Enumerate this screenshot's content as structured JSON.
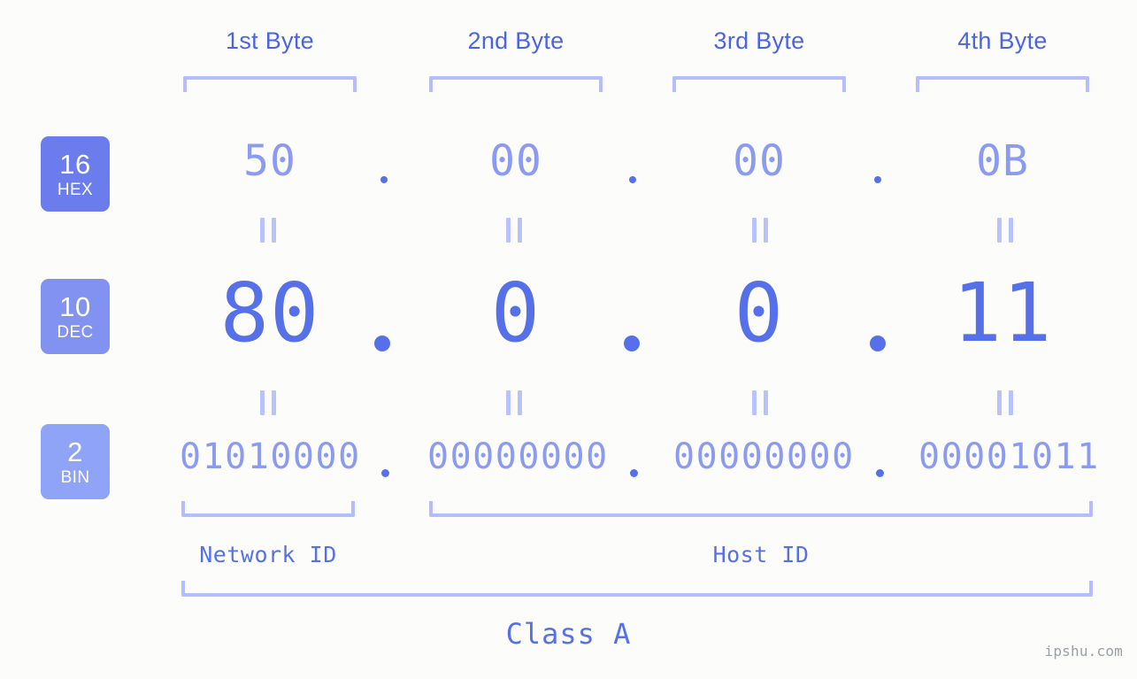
{
  "background_color": "#fcfdfa",
  "accent_color": "#5670ea",
  "light_accent_color": "#8c9bf2",
  "bracket_color": "#b4beff",
  "header": {
    "byte_labels": [
      {
        "label": "1st Byte"
      },
      {
        "label": "2nd Byte"
      },
      {
        "label": "3rd Byte"
      },
      {
        "label": "4th Byte"
      }
    ]
  },
  "rows": [
    {
      "key": "hex",
      "badge_number": "16",
      "badge_abbr": "HEX",
      "badge_color": "#6b7ced",
      "values": [
        "50",
        "00",
        "00",
        "0B"
      ],
      "separator": "."
    },
    {
      "key": "dec",
      "badge_number": "10",
      "badge_abbr": "DEC",
      "badge_color": "#8292f0",
      "values": [
        "80",
        "0",
        "0",
        "11"
      ],
      "separator": "."
    },
    {
      "key": "bin",
      "badge_number": "2",
      "badge_abbr": "BIN",
      "badge_color": "#8fa3f7",
      "values": [
        "01010000",
        "00000000",
        "00000000",
        "00001011"
      ],
      "separator": "."
    }
  ],
  "equals_marks": {
    "symbol": "=",
    "count_per_row": 4
  },
  "footer": {
    "network_id_label": "Network ID",
    "host_id_label": "Host ID",
    "class_label": "Class A"
  },
  "watermark": "ipshu.com"
}
